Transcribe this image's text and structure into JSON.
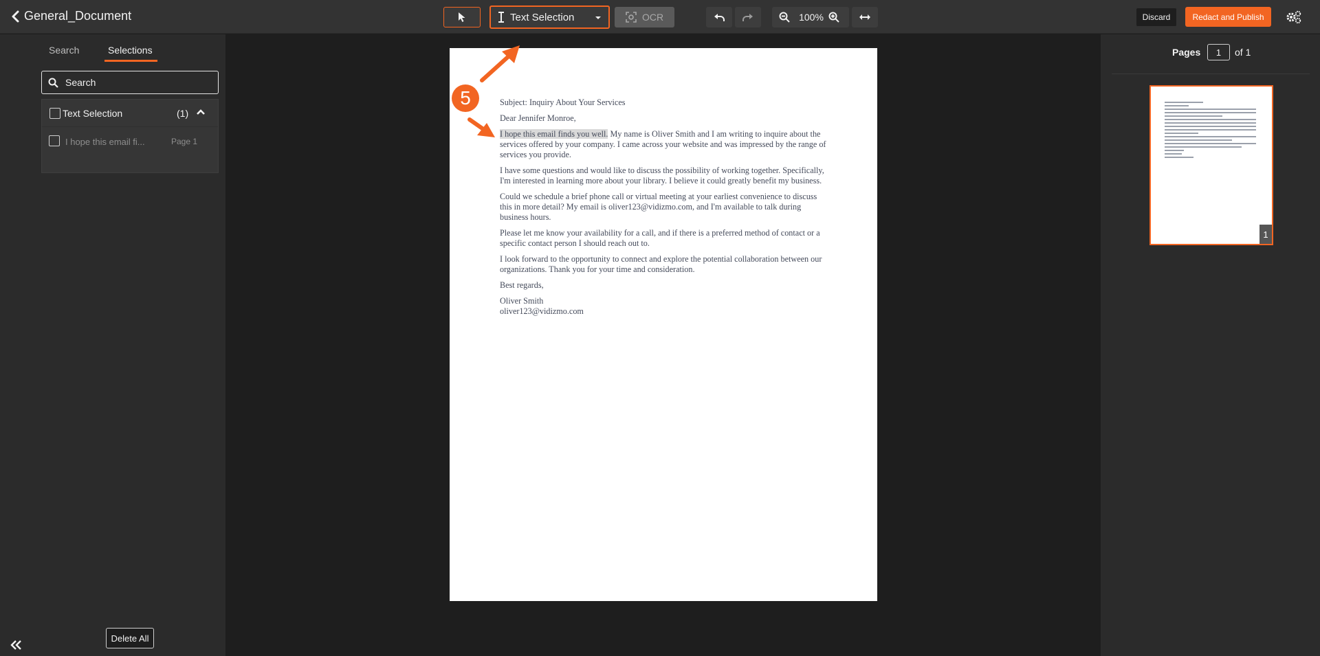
{
  "app": {
    "document_title": "General_Document"
  },
  "toolbar": {
    "mode_label": "Text Selection",
    "ocr_label": "OCR",
    "zoom_level": "100%",
    "discard_label": "Discard",
    "publish_label": "Redact and Publish"
  },
  "left_panel": {
    "tabs": [
      {
        "label": "Search",
        "active": false
      },
      {
        "label": "Selections",
        "active": true
      }
    ],
    "search_placeholder": "Search",
    "group": {
      "name": "Text Selection",
      "count": "(1)",
      "items": [
        {
          "text": "I hope this email fi...",
          "page": "Page 1"
        }
      ]
    },
    "delete_all_label": "Delete All"
  },
  "document": {
    "subject": "Subject: Inquiry About Your Services",
    "greeting": "Dear Jennifer Monroe,",
    "p1_highlight": "I hope this email finds you well.",
    "p1_rest": " My name is Oliver Smith and I am writing to inquire about the services offered by your company. I came across your website and was impressed by the range of services you provide.",
    "p2": "I have some questions and would like to discuss the possibility of working together. Specifically, I'm interested in learning more about your library. I believe it could greatly benefit my business.",
    "p3": "Could we schedule a brief phone call or virtual meeting at your earliest convenience to discuss this in more detail? My email is oliver123@vidizmo.com, and I'm available to talk during business hours.",
    "p4": "Please let me know your availability for a call, and if there is a preferred method of contact or a specific contact person I should reach out to.",
    "p5": "I look forward to the opportunity to connect and explore the potential collaboration between our organizations. Thank you for your time and consideration.",
    "closing": "Best regards,",
    "sig_name": "Oliver Smith",
    "sig_email": "oliver123@vidizmo.com"
  },
  "annotation": {
    "step_number": "5",
    "color": "#f26522"
  },
  "right_panel": {
    "pages_label": "Pages",
    "current_page": "1",
    "of_label": "of 1",
    "thumbnail_number": "1"
  },
  "colors": {
    "accent": "#f26522",
    "toolbar_bg": "#333333",
    "panel_bg": "#2b2b2b",
    "viewer_bg": "#1e1e1e"
  }
}
